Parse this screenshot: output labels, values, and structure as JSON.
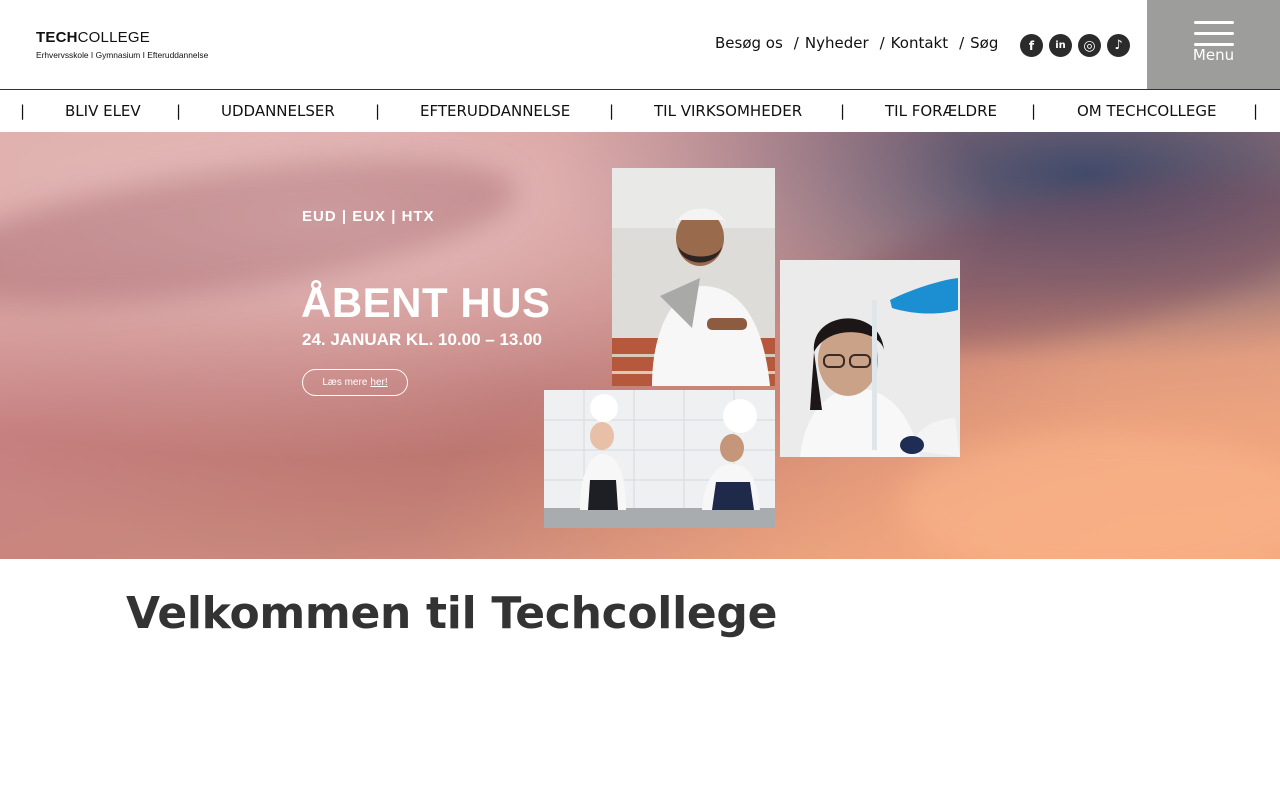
{
  "header": {
    "logo": {
      "brand_bold": "TECH",
      "brand_regular": "COLLEGE",
      "tagline": "Erhvervsskole I Gymnasium I Efteruddannelse"
    },
    "top_links": [
      {
        "label": "Besøg os"
      },
      {
        "label": "Nyheder"
      },
      {
        "label": "Kontakt"
      },
      {
        "label": "Søg"
      }
    ],
    "separator": "/",
    "social": [
      {
        "name": "facebook-icon",
        "glyph": "f"
      },
      {
        "name": "linkedin-icon",
        "glyph": "in"
      },
      {
        "name": "instagram-icon",
        "glyph": "◎"
      },
      {
        "name": "tiktok-icon",
        "glyph": "♪"
      }
    ],
    "menu_label": "Menu"
  },
  "main_nav": {
    "pipe": "|",
    "items": [
      {
        "label": "BLIV ELEV"
      },
      {
        "label": "UDDANNELSER"
      },
      {
        "label": "EFTERUDDANNELSE"
      },
      {
        "label": "TIL VIRKSOMHEDER"
      },
      {
        "label": "TIL FORÆLDRE"
      },
      {
        "label": "OM TECHCOLLEGE"
      }
    ]
  },
  "hero": {
    "tags": "EUD | EUX | HTX",
    "title": "ÅBENT HUS",
    "date": "24. JANUAR KL. 10.00 – 13.00",
    "cta_text": "Læs mere",
    "cta_link": "her!"
  },
  "content": {
    "title": "Velkommen til Techcollege"
  },
  "colors": {
    "menu_bg": "#9d9d9c",
    "title_text": "#333333",
    "icon_bg": "#2b2b2b"
  }
}
